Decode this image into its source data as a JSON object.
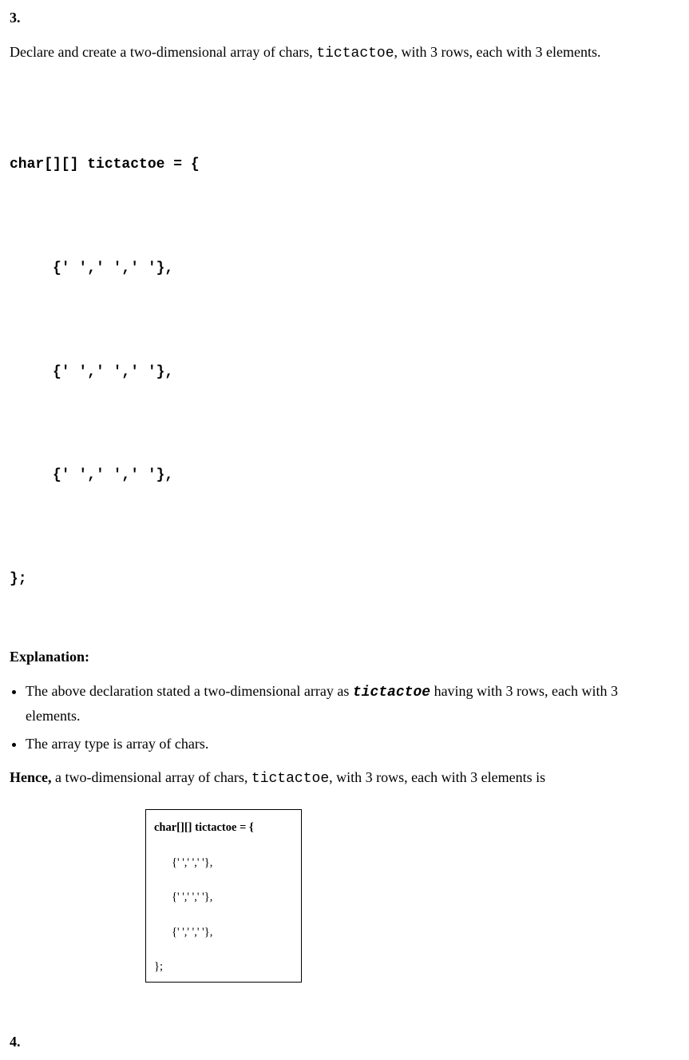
{
  "q3": {
    "number": "3.",
    "prompt_pre": "Declare and create a two-dimensional array of chars, ",
    "prompt_code": "tictactoe",
    "prompt_post": ", with 3 rows, each with 3 elements.",
    "code": {
      "l1": "char[][] tictactoe = {",
      "l2": "{' ',' ',' '},",
      "l3": "{' ',' ',' '},",
      "l4": "{' ',' ',' '},",
      "l5": "};"
    },
    "explanation_heading": "Explanation:",
    "bullets": {
      "b1_pre": "The above declaration stated a two-dimensional array as ",
      "b1_code": "tictactoe",
      "b1_post": " having with 3 rows, each with 3 elements.",
      "b2": "The array type is array of chars."
    },
    "hence": {
      "bold": "Hence,",
      "pre": " a two-dimensional array of chars, ",
      "code": "tictactoe",
      "post": ", with 3 rows, each with 3 elements is"
    },
    "box": {
      "l1": "char[][] tictactoe = {",
      "l2": "{' ',' ',' '},",
      "l3": "{' ',' ',' '},",
      "l4": "{' ',' ',' '},",
      "l5": "};"
    }
  },
  "q4": {
    "number": "4."
  }
}
